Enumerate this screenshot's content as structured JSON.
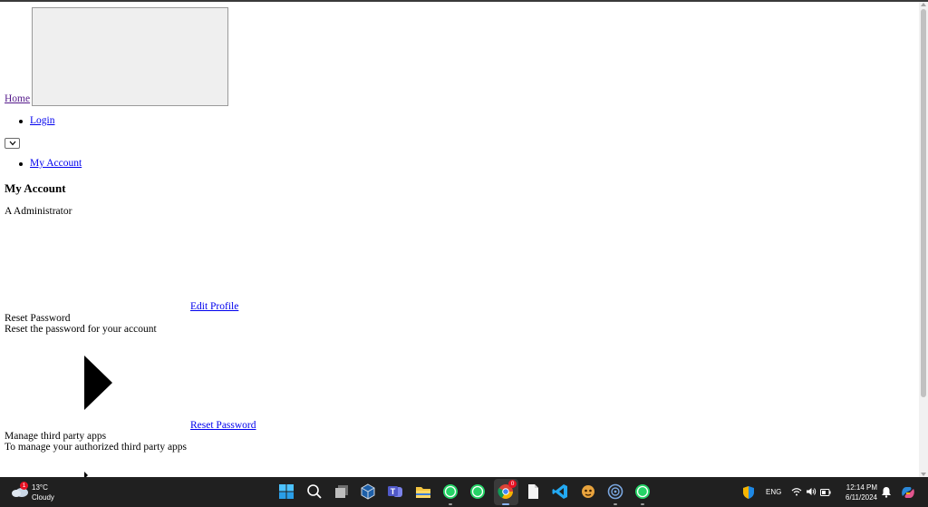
{
  "nav": {
    "home_link": "Home",
    "login_link": "Login",
    "my_account_link": "My Account"
  },
  "page": {
    "title": "My Account",
    "user_name": "A Administrator",
    "edit_profile_link": " Edit Profile",
    "reset_password_heading": "Reset Password",
    "reset_password_desc": "Reset the password for your account",
    "reset_password_link": " Reset Password",
    "third_party_heading": "Manage third party apps",
    "third_party_desc": "To manage your authorized third party apps"
  },
  "taskbar": {
    "weather_temp": "13°C",
    "weather_desc": "Cloudy",
    "weather_badge": "1",
    "chrome_badge": "0",
    "language": "ENG",
    "time": "12:14 PM",
    "date": "6/11/2024",
    "icons": [
      "windows-start",
      "search",
      "task-view",
      "virtualbox",
      "teams",
      "file-explorer",
      "whatsapp",
      "whatsapp",
      "chrome",
      "notepad",
      "vscode",
      "game",
      "app-circle",
      "whatsapp"
    ]
  },
  "colors": {
    "link": "#0000ee",
    "visited_link": "#551a8b",
    "taskbar_bg": "#202020"
  }
}
